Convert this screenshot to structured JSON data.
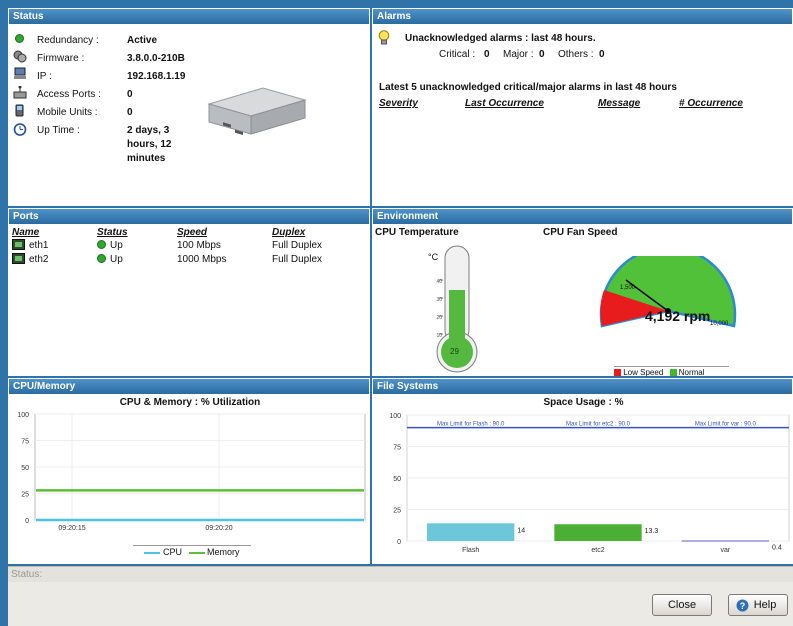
{
  "status": {
    "title": "Status",
    "rows": [
      {
        "label": "Redundancy :",
        "value": "Active",
        "icon": "green-status-icon"
      },
      {
        "label": "Firmware :",
        "value": "3.8.0.0-210B",
        "icon": "firmware-icon"
      },
      {
        "label": "IP :",
        "value": "192.168.1.19",
        "icon": "network-icon"
      },
      {
        "label": "Access Ports :",
        "value": "0",
        "icon": "access-port-icon"
      },
      {
        "label": "Mobile Units :",
        "value": "0",
        "icon": "mobile-unit-icon"
      },
      {
        "label": "Up Time :",
        "value_lines": [
          "2 days, 3",
          "hours, 12",
          "minutes"
        ],
        "icon": "clock-icon"
      }
    ]
  },
  "alarms": {
    "title": "Alarms",
    "unack_title": "Unacknowledged alarms : last 48 hours.",
    "critical_label": "Critical :",
    "critical_value": "0",
    "major_label": "Major :",
    "major_value": "0",
    "others_label": "Others :",
    "others_value": "0",
    "latest_title": "Latest 5 unacknowledged critical/major alarms in last 48 hours",
    "columns": [
      "Severity",
      "Last Occurrence",
      "Message",
      "# Occurrence"
    ]
  },
  "ports": {
    "title": "Ports",
    "columns": [
      "Name",
      "Status",
      "Speed",
      "Duplex"
    ],
    "rows": [
      {
        "name": "eth1",
        "status": "Up",
        "speed": "100 Mbps",
        "duplex": "Full Duplex"
      },
      {
        "name": "eth2",
        "status": "Up",
        "speed": "1000 Mbps",
        "duplex": "Full Duplex"
      }
    ]
  },
  "environment": {
    "title": "Environment",
    "cpu_temp_label": "CPU Temperature",
    "temp_unit": "°C",
    "temp_value": "29",
    "fan_label": "CPU Fan Speed",
    "fan_value": "4,192 rpm",
    "fan_tick_left": "1,500",
    "fan_tick_right": "10,000",
    "legend": [
      "Low Speed",
      "Normal"
    ],
    "colors": {
      "low": "#e81c1c",
      "normal": "#43b52f"
    }
  },
  "cpu_memory": {
    "title": "CPU/Memory",
    "chart_data": {
      "type": "line",
      "title": "CPU & Memory : % Utilization",
      "x": [
        "09:20:15",
        "09:20:20"
      ],
      "ylim": [
        0,
        100
      ],
      "yticks": [
        "100",
        "75",
        "50",
        "25",
        "0"
      ],
      "series": [
        {
          "name": "CPU",
          "values": [
            0,
            0
          ],
          "color": "#4cc3df"
        },
        {
          "name": "Memory",
          "values": [
            28,
            28
          ],
          "color": "#5dbe3a"
        }
      ]
    }
  },
  "file_systems": {
    "title": "File Systems",
    "chart_data": {
      "type": "bar",
      "title": "Space Usage : %",
      "categories": [
        "Flash",
        "etc2",
        "var"
      ],
      "values": [
        14,
        13.3,
        0.4
      ],
      "value_labels": [
        "14",
        "13.3",
        "0.4"
      ],
      "colors": [
        "#6cc7db",
        "#4caf35",
        "#5b62c4"
      ],
      "limits": [
        "Max Limit for Flash : 90.0",
        "Max Limit for etc2 : 90.0",
        "Max Limit for var : 90.0"
      ],
      "ylim": [
        0,
        100
      ],
      "yticks": [
        "100",
        "75",
        "50",
        "25",
        "0"
      ]
    }
  },
  "statusbar": {
    "text": "Status:"
  },
  "buttons": {
    "close": "Close",
    "help": "Help"
  }
}
